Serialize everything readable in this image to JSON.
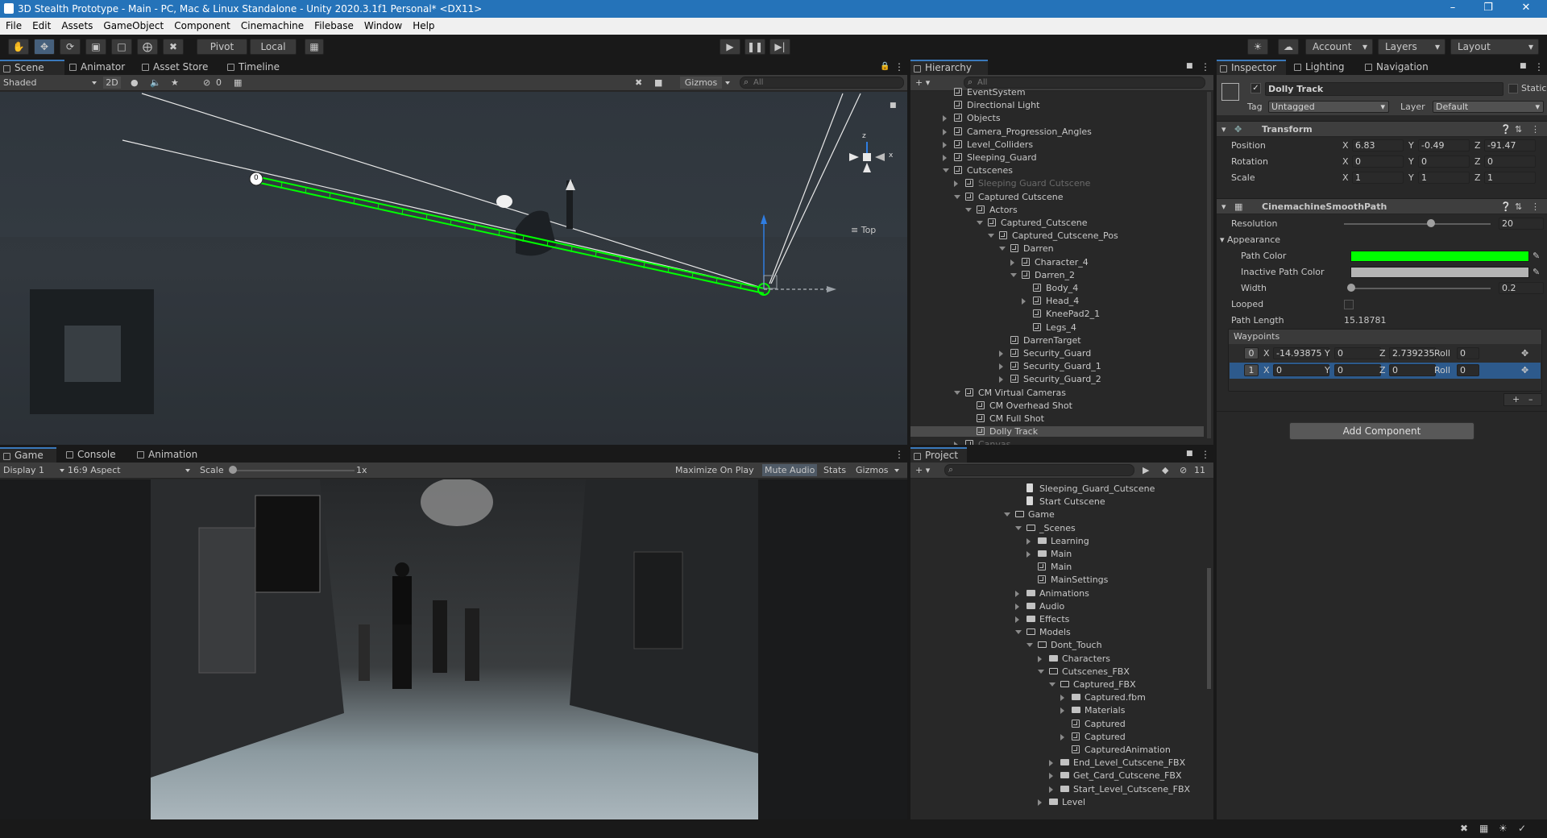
{
  "window": {
    "title": "3D Stealth Prototype - Main - PC, Mac & Linux Standalone - Unity 2020.3.1f1 Personal* <DX11>"
  },
  "menu": [
    "File",
    "Edit",
    "Assets",
    "GameObject",
    "Component",
    "Cinemachine",
    "Filebase",
    "Window",
    "Help"
  ],
  "toolbar": {
    "pivot": "Pivot",
    "local": "Local",
    "account": "Account",
    "layers": "Layers",
    "layout": "Layout"
  },
  "scene": {
    "tabs": [
      "Scene",
      "Animator",
      "Asset Store",
      "Timeline"
    ],
    "shading": "Shaded",
    "mode2d": "2D",
    "hidden_count": "0",
    "gizmos": "Gizmos",
    "search_placeholder": "All",
    "orientation": "Top",
    "waypoint_label": "0"
  },
  "game": {
    "tabs": [
      "Game",
      "Console",
      "Animation"
    ],
    "display": "Display 1",
    "aspect": "16:9 Aspect",
    "scale_label": "Scale",
    "scale_value": "1x",
    "maximize": "Maximize On Play",
    "mute": "Mute Audio",
    "stats": "Stats",
    "gizmos": "Gizmos"
  },
  "hierarchy": {
    "tab": "Hierarchy",
    "search_placeholder": "All",
    "rows": [
      {
        "label": "EventSystem",
        "depth": 0
      },
      {
        "label": "Directional Light",
        "depth": 0
      },
      {
        "label": "Objects",
        "depth": 0,
        "arrow": "closed"
      },
      {
        "label": "Camera_Progression_Angles",
        "depth": 0,
        "arrow": "closed"
      },
      {
        "label": "Level_Colliders",
        "depth": 0,
        "arrow": "closed"
      },
      {
        "label": "Sleeping_Guard",
        "depth": 0,
        "arrow": "closed"
      },
      {
        "label": "Cutscenes",
        "depth": 0,
        "arrow": "open"
      },
      {
        "label": "Sleeping Guard Cutscene",
        "depth": 1,
        "arrow": "closed",
        "dim": true
      },
      {
        "label": "Captured Cutscene",
        "depth": 1,
        "arrow": "open"
      },
      {
        "label": "Actors",
        "depth": 2,
        "arrow": "open"
      },
      {
        "label": "Captured_Cutscene",
        "depth": 3,
        "arrow": "open"
      },
      {
        "label": "Captured_Cutscene_Pos",
        "depth": 4,
        "arrow": "open"
      },
      {
        "label": "Darren",
        "depth": 5,
        "arrow": "open"
      },
      {
        "label": "Character_4",
        "depth": 6,
        "arrow": "closed"
      },
      {
        "label": "Darren_2",
        "depth": 6,
        "arrow": "open"
      },
      {
        "label": "Body_4",
        "depth": 7
      },
      {
        "label": "Head_4",
        "depth": 7,
        "arrow": "closed"
      },
      {
        "label": "KneePad2_1",
        "depth": 7
      },
      {
        "label": "Legs_4",
        "depth": 7
      },
      {
        "label": "DarrenTarget",
        "depth": 5
      },
      {
        "label": "Security_Guard",
        "depth": 5,
        "arrow": "closed"
      },
      {
        "label": "Security_Guard_1",
        "depth": 5,
        "arrow": "closed"
      },
      {
        "label": "Security_Guard_2",
        "depth": 5,
        "arrow": "closed"
      },
      {
        "label": "CM Virtual Cameras",
        "depth": 1,
        "arrow": "open"
      },
      {
        "label": "CM Overhead Shot",
        "depth": 2
      },
      {
        "label": "CM Full Shot",
        "depth": 2
      },
      {
        "label": "Dolly Track",
        "depth": 2,
        "selected": true
      },
      {
        "label": "Canvas",
        "depth": 1,
        "arrow": "closed",
        "dim": true
      }
    ]
  },
  "project": {
    "tab": "Project",
    "hidden_count": "11",
    "rows": [
      {
        "label": "Sleeping_Guard_Cutscene",
        "depth": 0,
        "icon": "doc"
      },
      {
        "label": "Start Cutscene",
        "depth": 0,
        "icon": "doc"
      },
      {
        "label": "Game",
        "depth": -1,
        "icon": "folder-open",
        "arrow": "open"
      },
      {
        "label": "_Scenes",
        "depth": 0,
        "icon": "folder-open",
        "arrow": "open"
      },
      {
        "label": "Learning",
        "depth": 1,
        "icon": "folder",
        "arrow": "closed"
      },
      {
        "label": "Main",
        "depth": 1,
        "icon": "folder",
        "arrow": "closed"
      },
      {
        "label": "Main",
        "depth": 1,
        "icon": "unity"
      },
      {
        "label": "MainSettings",
        "depth": 1,
        "icon": "settings"
      },
      {
        "label": "Animations",
        "depth": 0,
        "icon": "folder",
        "arrow": "closed"
      },
      {
        "label": "Audio",
        "depth": 0,
        "icon": "folder",
        "arrow": "closed"
      },
      {
        "label": "Effects",
        "depth": 0,
        "icon": "folder",
        "arrow": "closed"
      },
      {
        "label": "Models",
        "depth": 0,
        "icon": "folder-open",
        "arrow": "open"
      },
      {
        "label": "Dont_Touch",
        "depth": 1,
        "icon": "folder-open",
        "arrow": "open"
      },
      {
        "label": "Characters",
        "depth": 2,
        "icon": "folder",
        "arrow": "closed"
      },
      {
        "label": "Cutscenes_FBX",
        "depth": 2,
        "icon": "folder-open",
        "arrow": "open"
      },
      {
        "label": "Captured_FBX",
        "depth": 3,
        "icon": "folder-open",
        "arrow": "open"
      },
      {
        "label": "Captured.fbm",
        "depth": 4,
        "icon": "folder",
        "arrow": "closed"
      },
      {
        "label": "Materials",
        "depth": 4,
        "icon": "folder",
        "arrow": "closed"
      },
      {
        "label": "Captured",
        "depth": 4,
        "icon": "model"
      },
      {
        "label": "Captured",
        "depth": 4,
        "icon": "prefab",
        "arrow": "closed"
      },
      {
        "label": "CapturedAnimation",
        "depth": 4,
        "icon": "anim"
      },
      {
        "label": "End_Level_Cutscene_FBX",
        "depth": 3,
        "icon": "folder",
        "arrow": "closed"
      },
      {
        "label": "Get_Card_Cutscene_FBX",
        "depth": 3,
        "icon": "folder",
        "arrow": "closed"
      },
      {
        "label": "Start_Level_Cutscene_FBX",
        "depth": 3,
        "icon": "folder",
        "arrow": "closed"
      },
      {
        "label": "Level",
        "depth": 2,
        "icon": "folder",
        "arrow": "closed"
      }
    ]
  },
  "inspector": {
    "tabs": [
      "Inspector",
      "Lighting",
      "Navigation"
    ],
    "object_name": "Dolly Track",
    "static": "Static",
    "tag_label": "Tag",
    "tag_value": "Untagged",
    "layer_label": "Layer",
    "layer_value": "Default",
    "transform": {
      "title": "Transform",
      "position": {
        "label": "Position",
        "x": "6.83",
        "y": "-0.49",
        "z": "-91.47"
      },
      "rotation": {
        "label": "Rotation",
        "x": "0",
        "y": "0",
        "z": "0"
      },
      "scale": {
        "label": "Scale",
        "x": "1",
        "y": "1",
        "z": "1"
      }
    },
    "path": {
      "title": "CinemachineSmoothPath",
      "resolution_label": "Resolution",
      "resolution": "20",
      "resolution_fraction": 0.6,
      "appearance": "Appearance",
      "path_color_label": "Path Color",
      "path_color": "#00ff00",
      "inactive_color_label": "Inactive Path Color",
      "inactive_color": "#b4b4b4",
      "width_label": "Width",
      "width": "0.2",
      "width_fraction": 0.0,
      "looped_label": "Looped",
      "length_label": "Path Length",
      "length": "15.18781",
      "waypoints_label": "Waypoints",
      "waypoints": [
        {
          "index": "0",
          "x": "-14.93875",
          "y": "0",
          "z": "2.739235",
          "roll": "0"
        },
        {
          "index": "1",
          "x": "0",
          "y": "0",
          "z": "0",
          "roll": "0"
        }
      ]
    },
    "add_component": "Add Component",
    "axis": {
      "x": "X",
      "y": "Y",
      "z": "Z",
      "roll": "Roll"
    }
  }
}
